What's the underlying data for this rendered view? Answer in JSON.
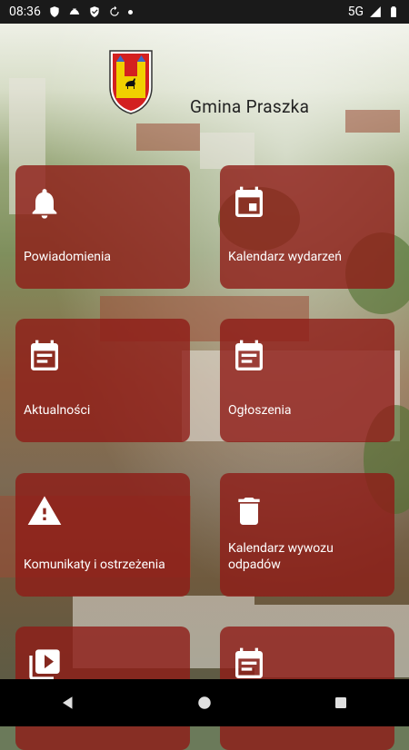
{
  "status_bar": {
    "time": "08:36",
    "network": "5G"
  },
  "header": {
    "title": "Gmina Praszka"
  },
  "tiles": [
    {
      "label": "Powiadomienia",
      "icon": "bell-icon"
    },
    {
      "label": "Kalendarz wydarzeń",
      "icon": "calendar-icon"
    },
    {
      "label": "Aktualności",
      "icon": "news-calendar-icon"
    },
    {
      "label": "Ogłoszenia",
      "icon": "announcement-calendar-icon"
    },
    {
      "label": "Komunikaty i ostrzeżenia",
      "icon": "warning-icon"
    },
    {
      "label": "Kalendarz wywozu odpadów",
      "icon": "trash-icon"
    },
    {
      "label": "",
      "icon": "video-icon"
    },
    {
      "label": "",
      "icon": "document-icon"
    }
  ],
  "colors": {
    "tile_bg": "#8f1c16",
    "status_bar": "#1a1a1a",
    "nav_bar": "#000000"
  }
}
